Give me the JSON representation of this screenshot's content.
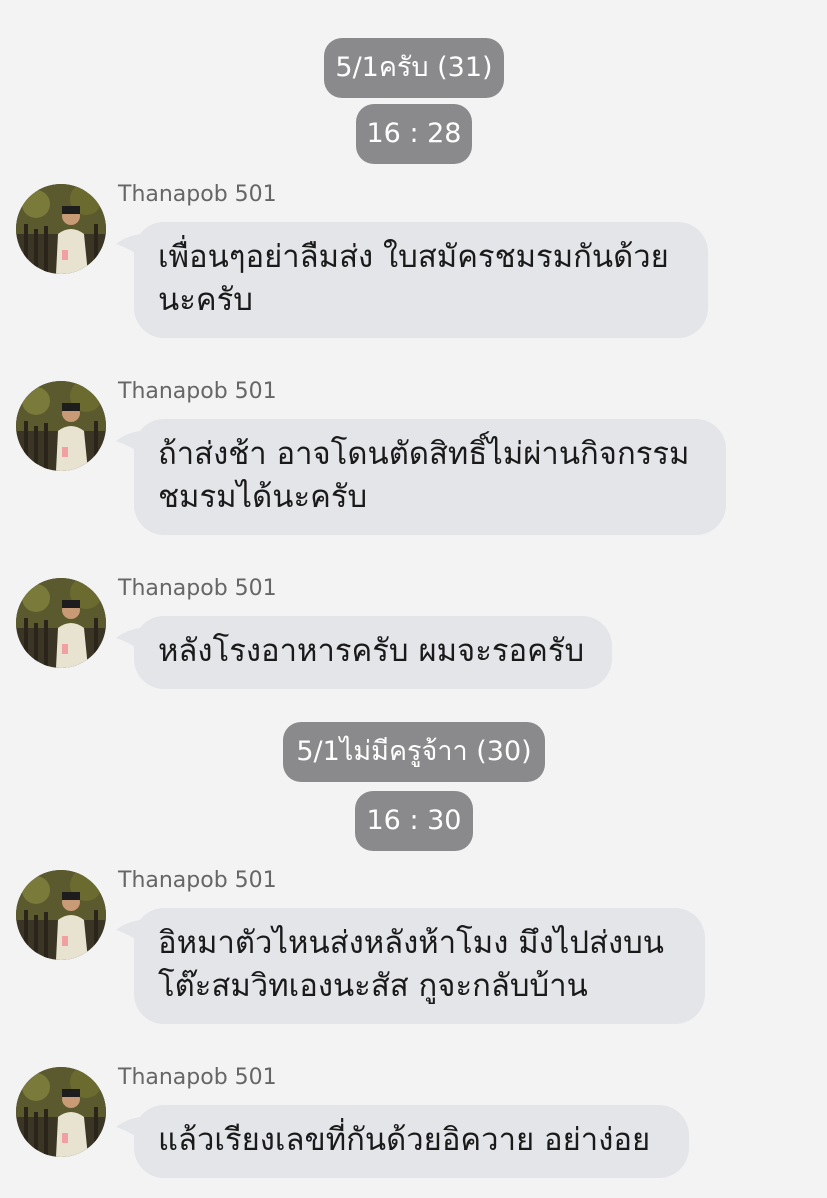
{
  "messages_feed": [
    {
      "type": "sender_pill",
      "text": "5/1ครับ (31)"
    },
    {
      "type": "time_pill",
      "text": "16 : 28"
    },
    {
      "type": "message",
      "sender": "Thanapob 501",
      "lines": [
        "เพื่อนๆอย่าลืมส่ง ใบสมัครชมรมกันด้วย",
        "นะครับ"
      ]
    },
    {
      "type": "message",
      "sender": "Thanapob 501",
      "lines": [
        "ถ้าส่งช้า อาจโดนตัดสิทธิ์ไม่ผ่านกิจกรรม",
        "ชมรมได้นะครับ"
      ]
    },
    {
      "type": "message",
      "sender": "Thanapob 501",
      "lines": [
        "หลังโรงอาหารครับ ผมจะรอครับ"
      ]
    },
    {
      "type": "sender_pill",
      "text": "5/1ไม่มีครูจ้าา (30)"
    },
    {
      "type": "time_pill",
      "text": "16 : 30"
    },
    {
      "type": "message",
      "sender": "Thanapob 501",
      "lines": [
        "อิหมาตัวไหนส่งหลังห้าโมง มึงไปส่งบน",
        "โต๊ะสมวิทเองนะสัส กูจะกลับบ้าน"
      ]
    },
    {
      "type": "message",
      "sender": "Thanapob 501",
      "lines": [
        "แล้วเรียงเลขที่กันด้วยอิควาย อย่าง่อย"
      ]
    }
  ],
  "pill1": {
    "text": "5/1ครับ (31)"
  },
  "time1": {
    "text": "16 : 28"
  },
  "msg1": {
    "sender": "Thanapob 501",
    "line1": "เพื่อนๆอย่าลืมส่ง ใบสมัครชมรมกันด้วย",
    "line2": "นะครับ"
  },
  "msg2": {
    "sender": "Thanapob 501",
    "line1": "ถ้าส่งช้า อาจโดนตัดสิทธิ์ไม่ผ่านกิจกรรม",
    "line2": "ชมรมได้นะครับ"
  },
  "msg3": {
    "sender": "Thanapob 501",
    "line1": "หลังโรงอาหารครับ ผมจะรอครับ"
  },
  "pill2": {
    "text": "5/1ไม่มีครูจ้าา (30)"
  },
  "time2": {
    "text": "16 : 30"
  },
  "msg4": {
    "sender": "Thanapob 501",
    "line1": "อิหมาตัวไหนส่งหลังห้าโมง มึงไปส่งบน",
    "line2": "โต๊ะสมวิทเองนะสัส กูจะกลับบ้าน"
  },
  "msg5": {
    "sender": "Thanapob 501",
    "line1": "แล้วเรียงเลขที่กันด้วยอิควาย อย่าง่อย"
  },
  "colors": {
    "background": "#f3f3f4",
    "pill": "#8a8a8c",
    "bubble": "#e4e5e9",
    "sender_text": "#666666"
  },
  "icons": {
    "avatar": "profile-photo-icon"
  }
}
